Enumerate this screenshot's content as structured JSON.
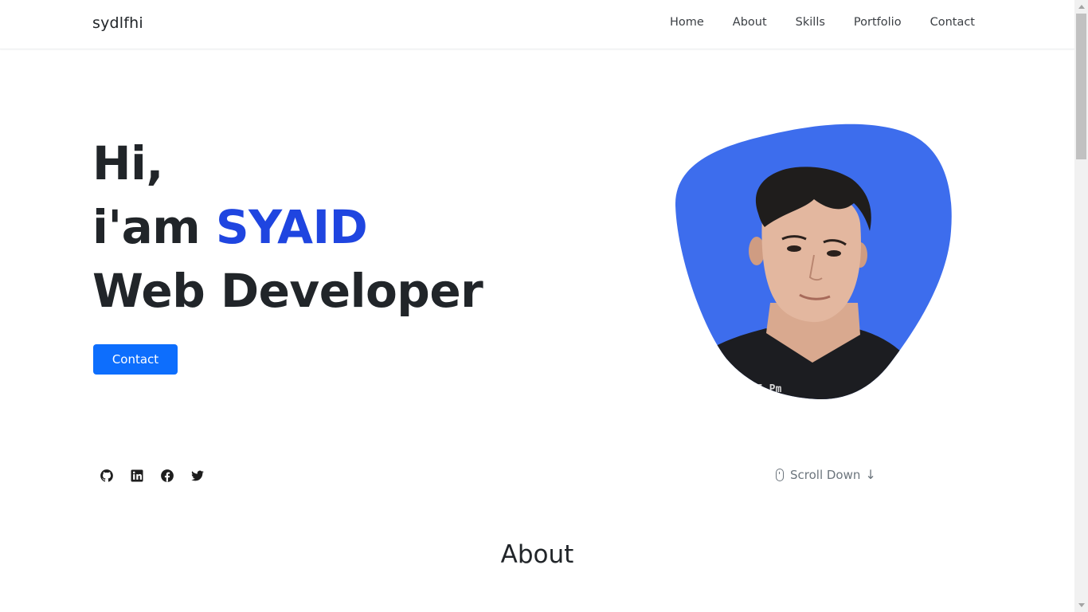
{
  "navbar": {
    "brand": "sydlfhi",
    "links": [
      "Home",
      "About",
      "Skills",
      "Portfolio",
      "Contact"
    ]
  },
  "hero": {
    "line1": "Hi,",
    "line2_prefix": "i'am ",
    "line2_name": "SYAID",
    "line3": "Web Developer",
    "button_label": "Contact",
    "photo_caption": "5 Pm"
  },
  "socials": [
    "github-icon",
    "linkedin-icon",
    "facebook-icon",
    "twitter-icon"
  ],
  "scroll": {
    "label": "Scroll Down"
  },
  "about": {
    "title": "About"
  },
  "colors": {
    "accent": "#1f45e0",
    "button": "#0d6efd",
    "blob": "#3d6ded"
  }
}
